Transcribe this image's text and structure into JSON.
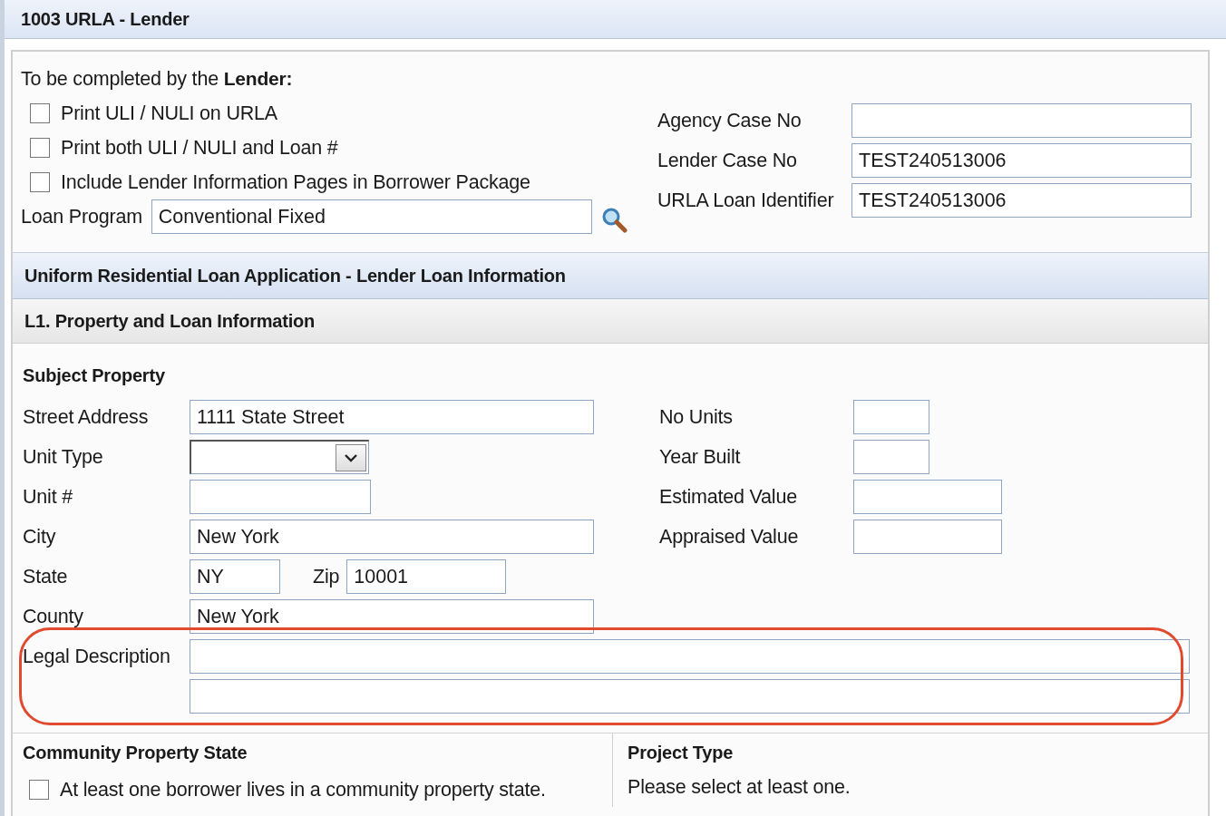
{
  "header": {
    "title": "1003 URLA - Lender"
  },
  "lender": {
    "intro": "To be completed by the **Lender:**",
    "checkboxes": [
      {
        "label": "Print ULI / NULI on URLA",
        "checked": false
      },
      {
        "label": "Print both ULI / NULI and Loan #",
        "checked": false
      },
      {
        "label": "Include Lender Information Pages in Borrower Package",
        "checked": false
      }
    ],
    "loan_program": {
      "label": "Loan Program",
      "value": "Conventional Fixed"
    },
    "fields": [
      {
        "label": "Agency Case No"
      },
      {
        "label": "Lender Case No",
        "value": "TEST240513006"
      },
      {
        "label": "URLA Loan Identifier",
        "value": "TEST240513006"
      }
    ]
  },
  "section_title": "Uniform Residential Loan Application - Lender Loan Information",
  "subsection_title": "L1. Property and Loan Information",
  "subject_property": {
    "heading": "Subject Property",
    "left_fields": [
      {
        "kind": "long",
        "label": "Street Address",
        "value": "1111 State Street"
      },
      {
        "kind": "select",
        "label": "Unit Type"
      },
      {
        "kind": "medium",
        "label": "Unit #"
      },
      {
        "kind": "long",
        "label": "City",
        "value": "New York"
      },
      {
        "kind": "state_zip",
        "label": "State",
        "value": "NY",
        "zip_label": "Zip",
        "zip_value": "10001"
      },
      {
        "kind": "long",
        "label": "County",
        "value": "New York"
      }
    ],
    "right_fields": [
      {
        "kind": "short",
        "label": "No Units"
      },
      {
        "kind": "short",
        "label": "Year Built"
      },
      {
        "kind": "medium",
        "label": "Estimated Value"
      },
      {
        "kind": "medium",
        "label": "Appraised Value"
      }
    ],
    "legal_description": {
      "label": "Legal Description"
    },
    "highlighted": true
  },
  "community_property": {
    "heading": "Community Property State",
    "checkboxes": [
      {
        "label": "At least one borrower lives in a community property state.",
        "checked": false
      }
    ]
  },
  "project_type": {
    "heading": "Project Type",
    "note": "Please select at least one."
  }
}
